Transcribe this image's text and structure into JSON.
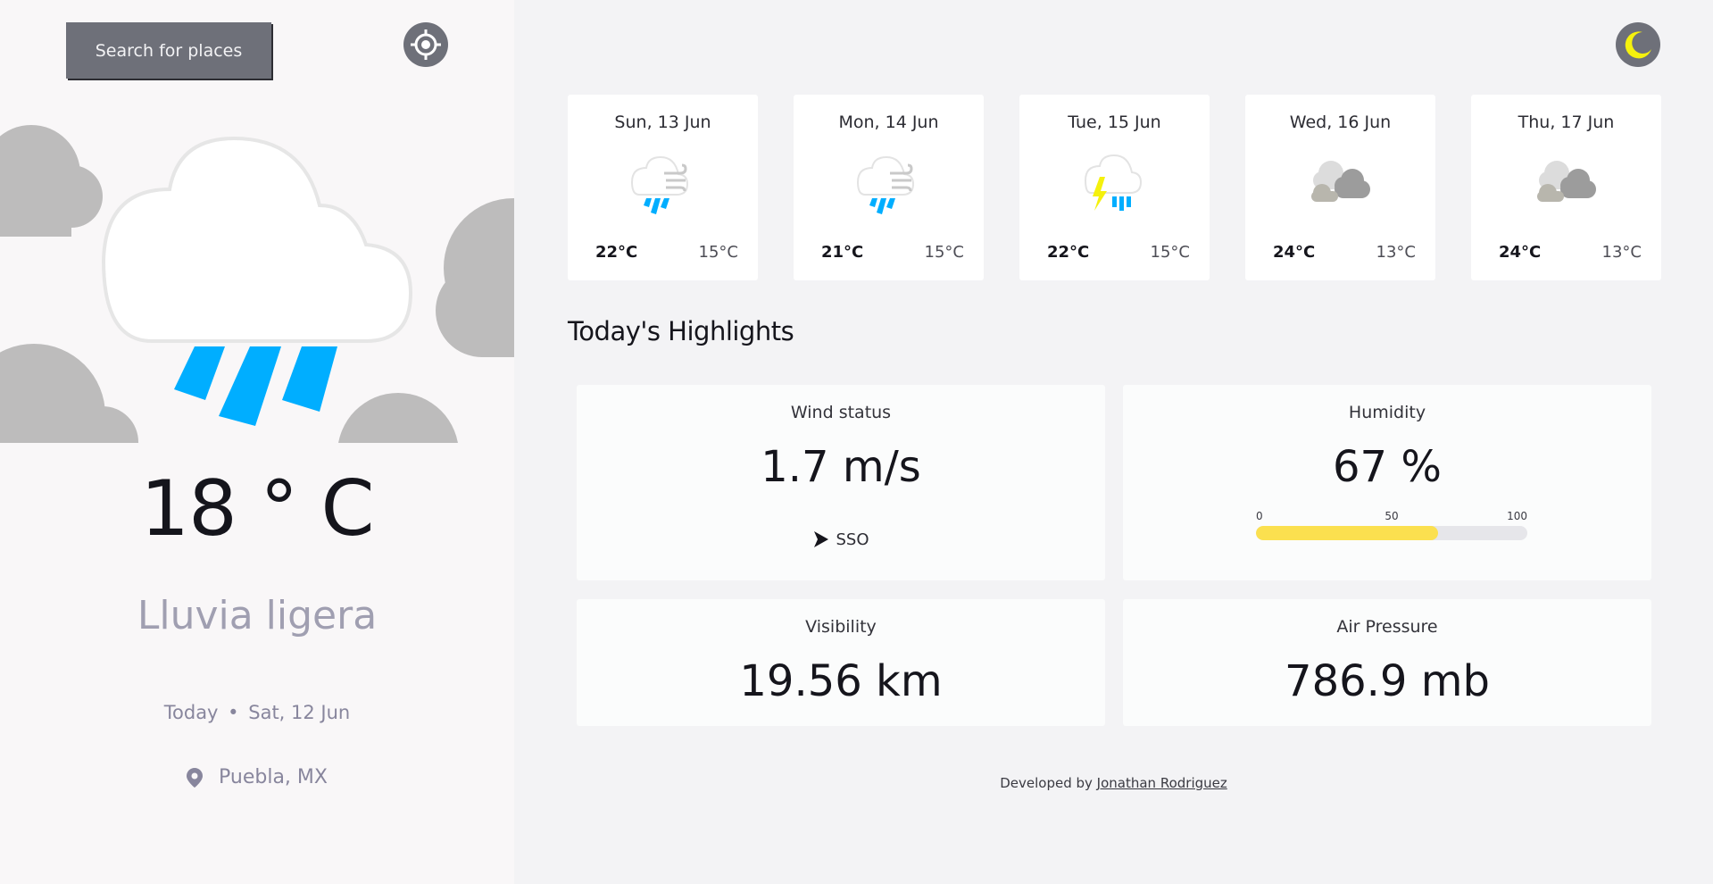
{
  "sidebar": {
    "search_label": "Search for places",
    "temperature": "18 ° C",
    "condition": "Lluvia ligera",
    "today_label": "Today",
    "date_separator": "•",
    "date": "Sat, 12 Jun",
    "location": "Puebla, MX",
    "main_icon": "light-rain-cloud-icon"
  },
  "forecast": [
    {
      "day": "Sun, 13 Jun",
      "max": "22°C",
      "min": "15°C",
      "icon": "rain-wind-icon"
    },
    {
      "day": "Mon, 14 Jun",
      "max": "21°C",
      "min": "15°C",
      "icon": "rain-wind-icon"
    },
    {
      "day": "Tue, 15 Jun",
      "max": "22°C",
      "min": "15°C",
      "icon": "thunderstorm-icon"
    },
    {
      "day": "Wed, 16 Jun",
      "max": "24°C",
      "min": "13°C",
      "icon": "cloudy-icon"
    },
    {
      "day": "Thu, 17 Jun",
      "max": "24°C",
      "min": "13°C",
      "icon": "cloudy-icon"
    }
  ],
  "highlights": {
    "title": "Today's Highlights",
    "wind": {
      "label": "Wind status",
      "value": "1.7 m/s",
      "direction": "SSO"
    },
    "humidity": {
      "label": "Humidity",
      "value": "67 %",
      "percent": 67,
      "scale": [
        "0",
        "50",
        "100"
      ]
    },
    "visibility": {
      "label": "Visibility",
      "value": "19.56 km"
    },
    "pressure": {
      "label": "Air Pressure",
      "value": "786.9 mb"
    }
  },
  "footer": {
    "prefix": "Developed by",
    "author": "Jonathan Rodriguez"
  },
  "colors": {
    "rain_blue": "#00aeff",
    "sun_yellow": "#fbe04f",
    "button_gray": "#6e7079",
    "cloud_gray": "#bdbcbc"
  }
}
